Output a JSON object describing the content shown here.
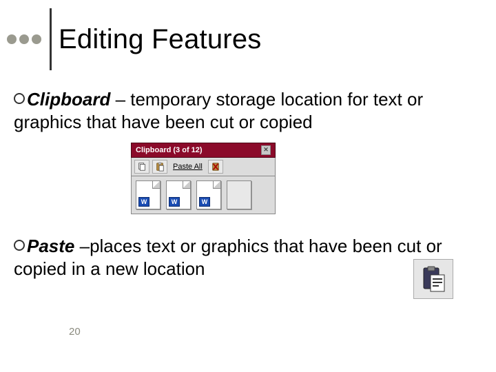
{
  "title": "Editing Features",
  "page_number": "20",
  "bullets": [
    {
      "term": "Clipboard",
      "desc": " – temporary storage location for text or graphics that have been cut or copied"
    },
    {
      "term": "Paste",
      "desc": " –places text or graphics that have been cut or copied in a new location"
    }
  ],
  "clipboard_panel": {
    "title": "Clipboard (3 of 12)",
    "paste_all_label": "Paste All",
    "item_badge": "W"
  }
}
